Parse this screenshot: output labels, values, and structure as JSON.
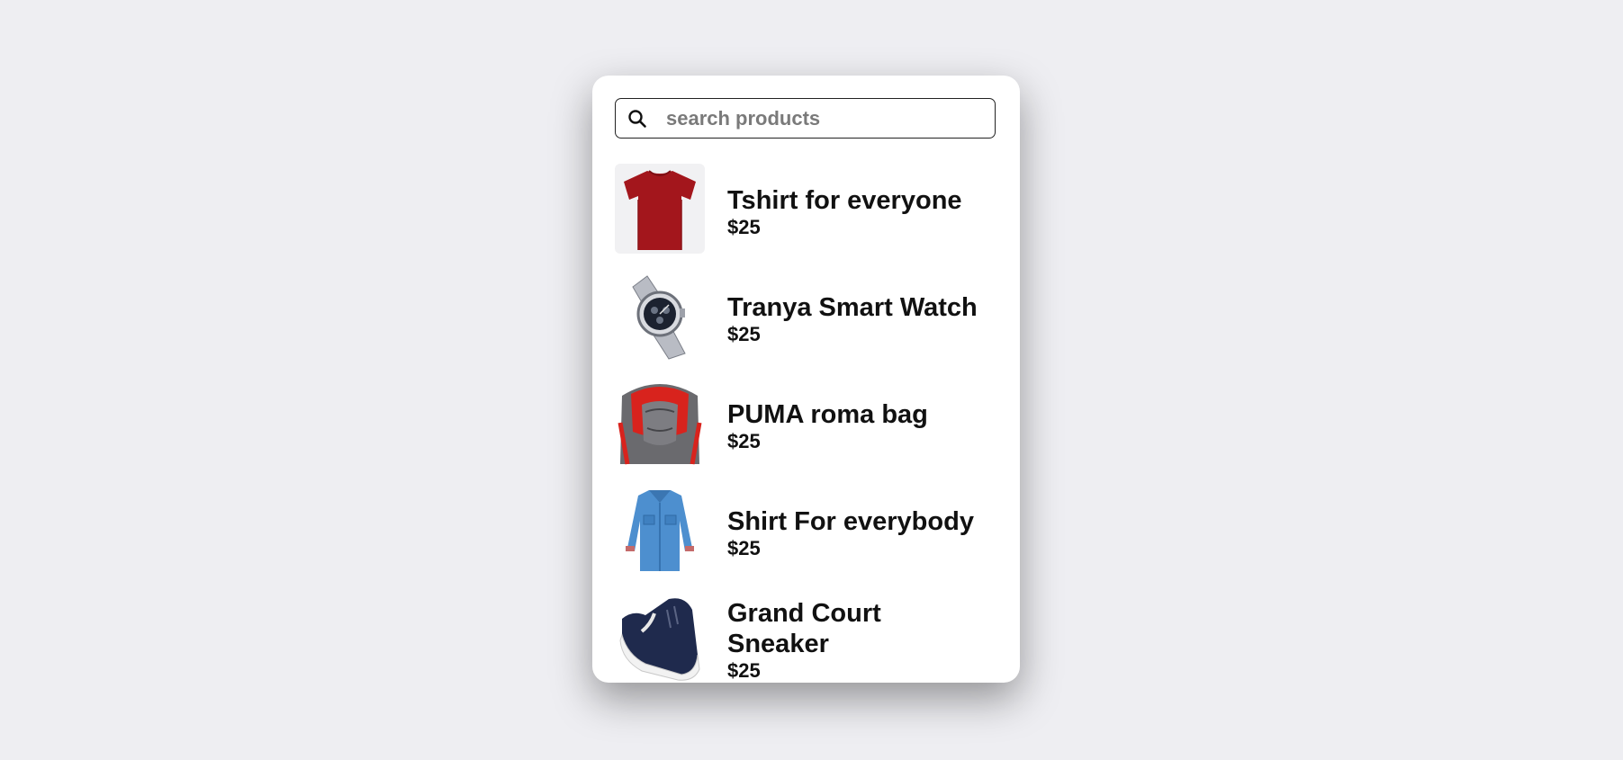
{
  "search": {
    "placeholder": "search products",
    "value": ""
  },
  "products": [
    {
      "name": "Tshirt for everyone",
      "price": "$25",
      "image": "red-tshirt"
    },
    {
      "name": "Tranya Smart Watch",
      "price": "$25",
      "image": "silver-watch"
    },
    {
      "name": "PUMA roma bag",
      "price": "$25",
      "image": "red-grey-backpack"
    },
    {
      "name": "Shirt For everybody",
      "price": "$25",
      "image": "blue-denim-shirt"
    },
    {
      "name": "Grand Court Sneaker",
      "price": "$25",
      "image": "navy-sneaker"
    }
  ],
  "colors": {
    "background": "#eeeef2",
    "card": "#ffffff",
    "text": "#111111"
  }
}
